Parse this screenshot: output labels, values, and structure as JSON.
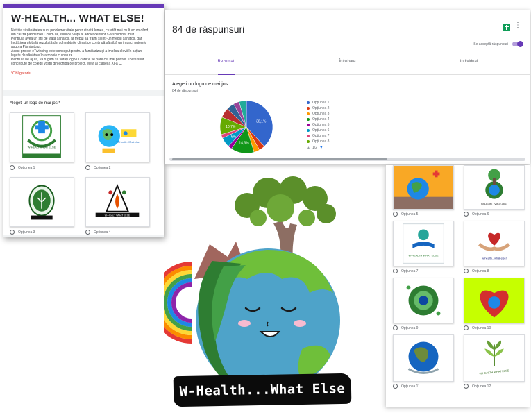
{
  "form": {
    "title": "W-HEALTH... WHAT ELSE!",
    "description": [
      "Nutriția și sănătatea sunt probleme vitale pentru toată lumea, cu atât mai mult acum când,",
      "din cauza pandemiei Covid-19, stilul de viață al adolescenților s-a schimbat mult.",
      "Pentru a avea un stil de viață sănătos, ar trebui să trăim și într-un mediu sănătos, dar",
      "încălzirea globală rezultată din schimbările climatice continuă să aibă un impact puternic",
      "asupra Pământului.",
      "Acest proiect eTwinning este conceput pentru a familiariza și a implica elevii în acțiuni",
      "legate de sănătate în armonie cu natura.",
      "Pentru a ne ajuta, vă rugăm să votați logo-ul care vi se pare cel mai potrivit. Toate sunt",
      "concepute de colegii voștri din echipa de proiect, elevi ai clasei a XI-a C."
    ],
    "required_note": "*Obligatoriu",
    "question": "Alegeti un logo de mai jos *",
    "options": [
      "Opțiunea 1",
      "Opțiunea 2",
      "Opțiunea 3",
      "Opțiunea 4"
    ],
    "logo_texts": [
      "W-HEALT WHAT ELSE",
      "W-Health...What else!",
      "",
      "W-HEALT WHAT ELSE"
    ]
  },
  "responses": {
    "count_title": "84 de răspunsuri",
    "sheets_icon": "google-sheets-icon",
    "more_icon": "⋮",
    "accept_label": "Se acceptă răspunsuri",
    "accepting": true,
    "tabs": [
      "Rezumat",
      "Întrebare",
      "Individual"
    ],
    "active_tab": 0,
    "question_title": "Alegeti un logo de mai jos",
    "question_sub": "84 de răspunsuri",
    "pager": "1/2",
    "pager_up": "▲",
    "pager_down": "▼"
  },
  "chart_data": {
    "type": "pie",
    "title": "",
    "labels": [
      "Opțiunea 1",
      "Opțiunea 2",
      "Opțiunea 3",
      "Opțiunea 4",
      "Opțiunea 5",
      "Opțiunea 6",
      "Opțiunea 7",
      "Opțiunea 8",
      "Opțiunea 9",
      "Opțiunea 10",
      "Opțiunea 11",
      "Opțiunea 12"
    ],
    "values": [
      38.1,
      3.6,
      3.6,
      14.3,
      2.4,
      6.0,
      2.4,
      10.7,
      6.0,
      4.8,
      3.6,
      4.5
    ],
    "data_labels": [
      "38,1%",
      "",
      "",
      "14,3%",
      "",
      "6%",
      "",
      "10,7%",
      "",
      "",
      "",
      ""
    ],
    "legend_visible_count": 8,
    "legend_position": "right",
    "colors": [
      "#3366cc",
      "#dc3912",
      "#ff9900",
      "#109618",
      "#990099",
      "#0099c6",
      "#dd4477",
      "#66aa00",
      "#b82e2e",
      "#316395",
      "#994499",
      "#22aa99"
    ]
  },
  "gallery": {
    "options": [
      "Opțiunea 5",
      "Opțiunea 6",
      "Opțiunea 7",
      "Opțiunea 8",
      "Opțiunea 9",
      "Opțiunea 10",
      "Opțiunea 11",
      "Opțiunea 12"
    ],
    "logo_texts": [
      "",
      "W-Health...What else!",
      "W-HEALTH WHAT ELSE",
      "w-health...what else!",
      "",
      "",
      "",
      "W-HEALTH WHAT ELSE"
    ]
  },
  "mascot": {
    "banner_text": "W-Health...What Else"
  },
  "theme": {
    "accent": "#673ab7",
    "required": "#d93025"
  }
}
